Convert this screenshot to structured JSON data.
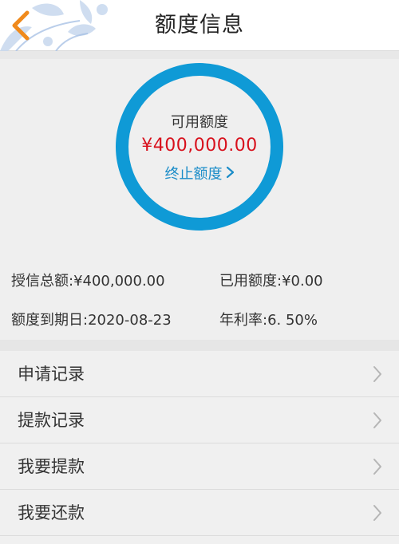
{
  "header": {
    "title": "额度信息",
    "back_icon": "chevron-left-icon",
    "accent_color": "#f08a1c"
  },
  "summary": {
    "available_label": "可用额度",
    "available_amount": "¥400,000.00",
    "terminate_label": "终止额度",
    "terminate_icon": "chevron-right-icon",
    "ring_color": "#0f9ad6",
    "amount_color": "#d8101c",
    "link_color": "#1a8cc8"
  },
  "info": {
    "total_credit": "授信总额:¥400,000.00",
    "used_credit": "已用额度:¥0.00",
    "expire_date": "额度到期日:2020-08-23",
    "annual_rate": "年利率:6. 50%"
  },
  "menu": {
    "items": [
      {
        "label": "申请记录"
      },
      {
        "label": "提款记录"
      },
      {
        "label": "我要提款"
      },
      {
        "label": "我要还款"
      }
    ],
    "arrow_icon": "chevron-right-icon"
  }
}
